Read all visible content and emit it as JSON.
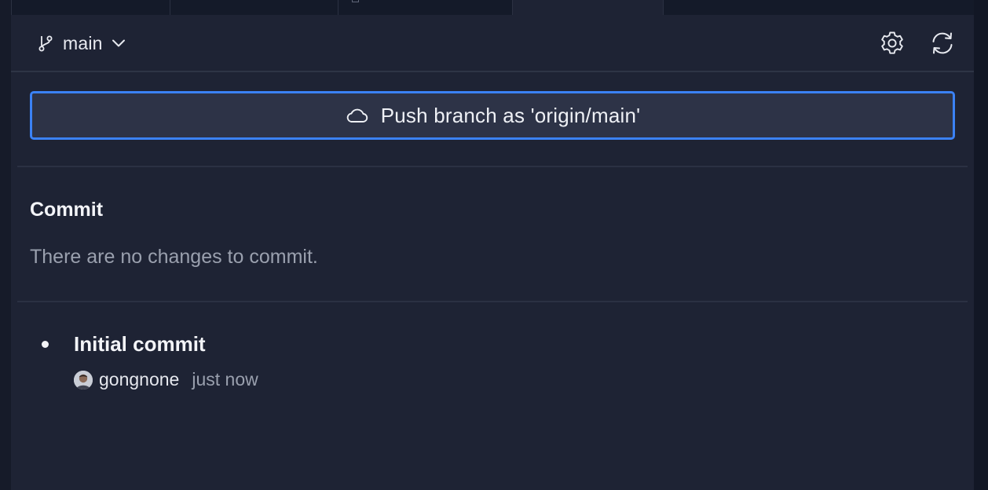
{
  "branch": {
    "name": "main"
  },
  "push_button": {
    "label": "Push branch as 'origin/main'"
  },
  "commit_section": {
    "title": "Commit",
    "empty_message": "There are no changes to commit."
  },
  "history": [
    {
      "title": "Initial commit",
      "author": "gongnone",
      "time": "just now"
    }
  ],
  "colors": {
    "panel_bg": "#1e2334",
    "accent": "#3b82f6",
    "muted_text": "#9aa0ae"
  },
  "icons": [
    "git-branch-icon",
    "chevron-down-icon",
    "gear-icon",
    "sync-icon",
    "cloud-icon"
  ]
}
